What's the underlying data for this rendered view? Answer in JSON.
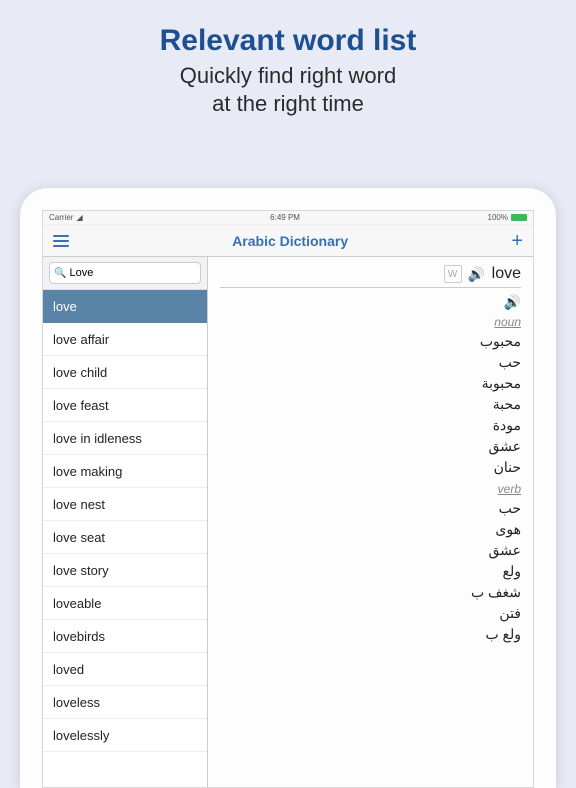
{
  "promo": {
    "title": "Relevant word list",
    "subtitle_line1": "Quickly find right word",
    "subtitle_line2": "at the right time"
  },
  "status": {
    "carrier": "Carrier",
    "time": "6:49 PM",
    "battery_pct": "100%"
  },
  "navbar": {
    "title": "Arabic Dictionary"
  },
  "search": {
    "value": "Love"
  },
  "word_list": [
    "love",
    "love affair",
    "love child",
    "love feast",
    "love in idleness",
    "love making",
    "love nest",
    "love seat",
    "love story",
    "loveable",
    "lovebirds",
    "loved",
    "loveless",
    "lovelessly"
  ],
  "detail": {
    "word": "love",
    "pos_noun": "noun",
    "noun_translations": [
      "محبوب",
      "حب",
      "محبوبة",
      "محبة",
      "مودة",
      "عشق",
      "حنان"
    ],
    "pos_verb": "verb",
    "verb_translations": [
      "حب",
      "هوى",
      "عشق",
      "ولع",
      "شغف ب",
      "فتن",
      "ولع ب"
    ]
  }
}
